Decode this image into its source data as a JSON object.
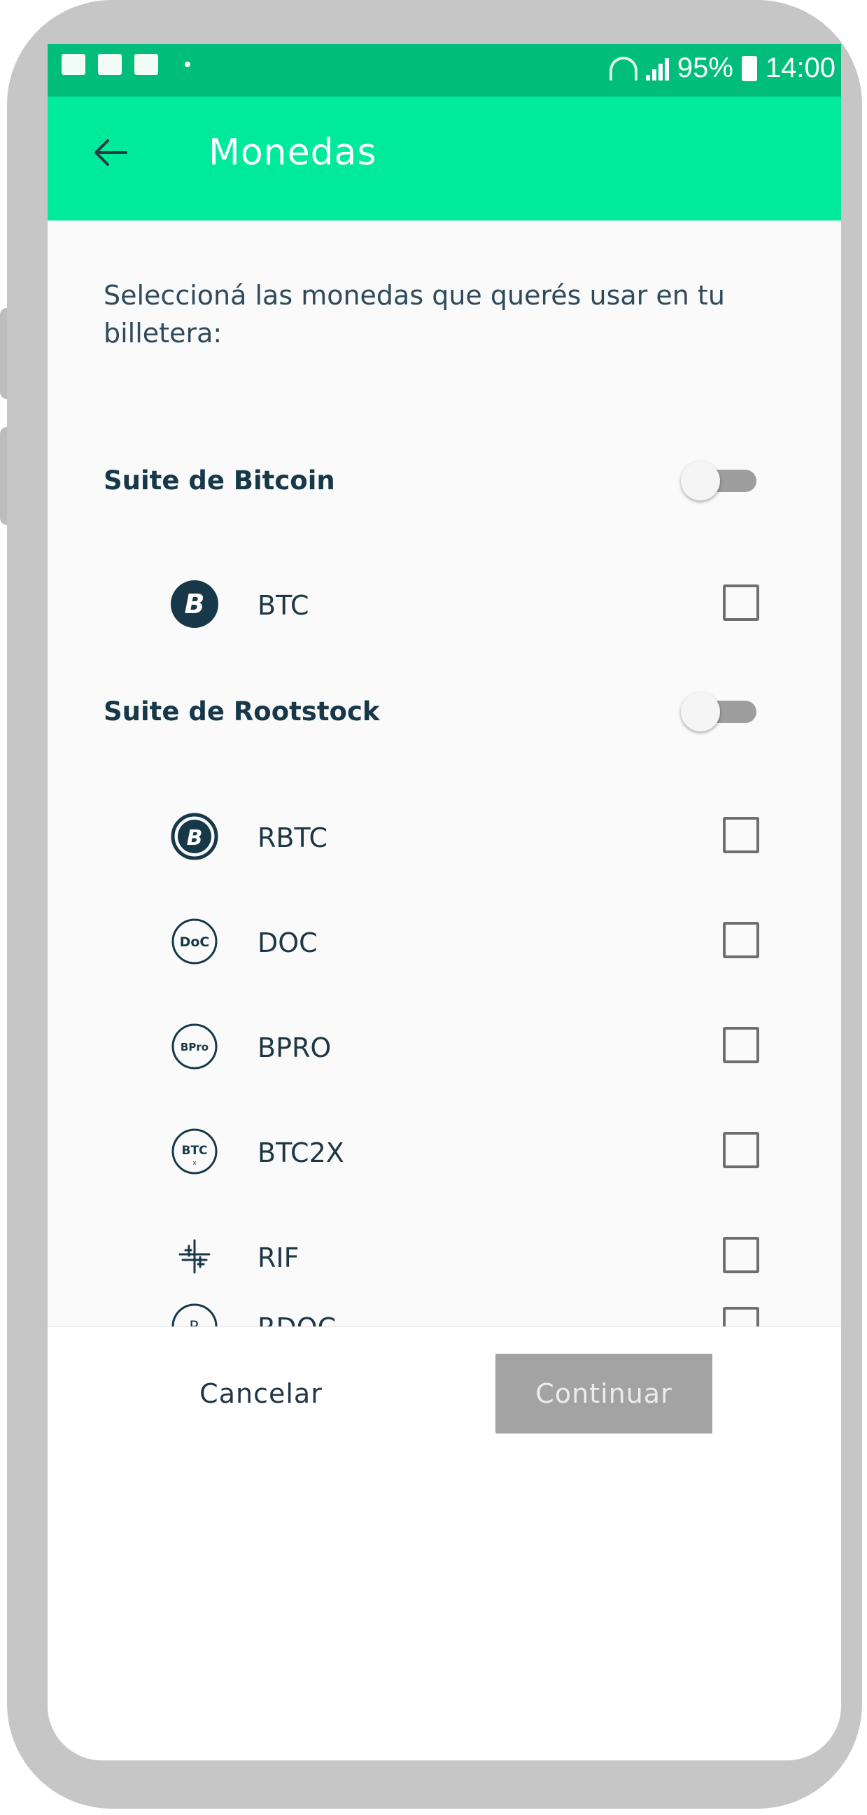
{
  "status_bar": {
    "battery": "95%",
    "time": "14:00"
  },
  "app_bar": {
    "title": "Monedas"
  },
  "instructions": "Seleccioná las monedas que querés usar en tu billetera:",
  "sections": [
    {
      "title": "Suite de Bitcoin",
      "toggle_on": false,
      "coins": [
        {
          "label": "BTC",
          "checked": false
        }
      ]
    },
    {
      "title": "Suite de Rootstock",
      "toggle_on": false,
      "coins": [
        {
          "label": "RBTC",
          "checked": false
        },
        {
          "label": "DOC",
          "checked": false
        },
        {
          "label": "BPRO",
          "checked": false
        },
        {
          "label": "BTC2X",
          "checked": false
        },
        {
          "label": "RIF",
          "checked": false
        },
        {
          "label": "RDOC",
          "checked": false
        }
      ]
    }
  ],
  "icon_text": {
    "btc": "B",
    "rbtc": "B",
    "doc": "DoC",
    "bpro": "BPro",
    "btc2x": "BTC",
    "btc2x_sub": "x",
    "rdoc": "R"
  },
  "footer": {
    "cancel_label": "Cancelar",
    "continue_label": "Continuar"
  },
  "colors": {
    "status_bar": "#00bd7c",
    "app_bar": "#00ea9c",
    "continue_disabled": "#a3a3a3",
    "heading_text": "#163848"
  }
}
